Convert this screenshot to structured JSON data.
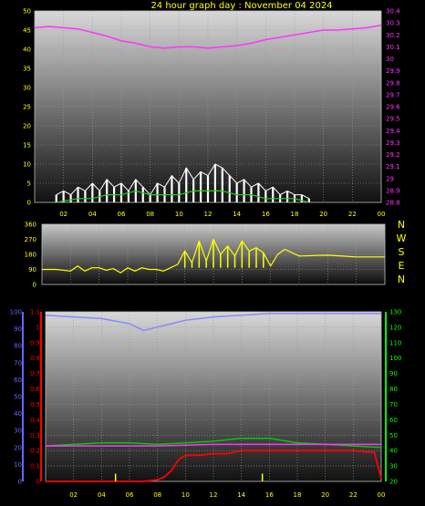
{
  "title": "24 hour graph day : November 04 2024",
  "colors": {
    "background": "#000000",
    "text": "#ffff00",
    "pressure": "#ff33ff",
    "wind_speed": "#ffffff",
    "wind_avg": "#22cc22",
    "wind_dir": "#ffff00",
    "humidity": "#8888ff",
    "temperature": "#00cc00",
    "rain_rate": "#ff0000",
    "rain_total": "#ffff00",
    "axis_blue": "#6666ff",
    "axis_red": "#ff0000",
    "axis_green": "#00ff00"
  },
  "chart_data": [
    {
      "type": "line",
      "name": "wind_and_pressure",
      "x_ticks": [
        "02",
        "04",
        "06",
        "08",
        "10",
        "12",
        "14",
        "16",
        "18",
        "20",
        "22",
        "00"
      ],
      "y_left": {
        "ticks": [
          "0",
          "5",
          "10",
          "15",
          "20",
          "25",
          "30",
          "35",
          "40",
          "45",
          "50"
        ],
        "range": [
          0,
          50
        ]
      },
      "y_right": {
        "ticks": [
          "28.8",
          "28.9",
          "29",
          "29.1",
          "29.2",
          "29.3",
          "29.4",
          "29.5",
          "29.6",
          "29.7",
          "29.8",
          "29.9",
          "30",
          "30.1",
          "30.2",
          "30.3",
          "30.4"
        ],
        "range": [
          28.8,
          30.4
        ]
      },
      "grid": true,
      "x_range": [
        0,
        24
      ],
      "series": [
        {
          "key": "pressure",
          "axis": "right",
          "x": [
            0,
            1,
            2,
            3,
            4,
            5,
            6,
            7,
            8,
            9,
            10,
            11,
            12,
            13,
            14,
            15,
            16,
            17,
            18,
            19,
            20,
            21,
            22,
            23,
            24
          ],
          "values": [
            30.26,
            30.27,
            30.26,
            30.25,
            30.22,
            30.19,
            30.15,
            30.13,
            30.1,
            30.09,
            30.1,
            30.1,
            30.09,
            30.1,
            30.11,
            30.13,
            30.16,
            30.18,
            30.2,
            30.22,
            30.24,
            30.24,
            30.25,
            30.26,
            30.28
          ]
        },
        {
          "key": "wind_speed",
          "axis": "left",
          "x": [
            1.5,
            2,
            2.5,
            3,
            3.5,
            4,
            4.5,
            5,
            5.5,
            6,
            6.5,
            7,
            7.5,
            8,
            8.5,
            9,
            9.5,
            10,
            10.5,
            11,
            11.5,
            12,
            12.5,
            13,
            13.5,
            14,
            14.5,
            15,
            15.5,
            16,
            16.5,
            17,
            17.5,
            18,
            18.5,
            19
          ],
          "values": [
            2,
            3,
            2,
            4,
            3,
            5,
            3,
            6,
            4,
            5,
            3,
            6,
            4,
            2,
            5,
            4,
            7,
            5,
            9,
            6,
            8,
            7,
            10,
            9,
            7,
            5,
            6,
            4,
            5,
            3,
            4,
            2,
            3,
            2,
            2,
            1
          ]
        },
        {
          "key": "wind_avg",
          "axis": "left",
          "x": [
            1.5,
            3,
            4,
            5,
            6,
            7,
            8,
            9,
            10,
            11,
            12,
            13,
            14,
            15,
            16,
            17,
            18,
            19
          ],
          "values": [
            0,
            1,
            1,
            2,
            2,
            3,
            2,
            2,
            2,
            3,
            3,
            3,
            2,
            2,
            1,
            1,
            1,
            0
          ]
        }
      ]
    },
    {
      "type": "line",
      "name": "wind_direction",
      "y_left": {
        "ticks": [
          "0",
          "90",
          "180",
          "270",
          "360"
        ],
        "range": [
          0,
          360
        ]
      },
      "direction_labels": [
        "N",
        "W",
        "S",
        "E",
        "N"
      ],
      "grid": true,
      "x_range": [
        0,
        24
      ],
      "series": [
        {
          "key": "wind_dir",
          "x": [
            0,
            1,
            2,
            2.5,
            3,
            3.5,
            4,
            4.5,
            5,
            5.5,
            6,
            6.5,
            7,
            7.5,
            8,
            8.5,
            9,
            9.5,
            10,
            10.5,
            11,
            11.5,
            12,
            12.5,
            13,
            13.5,
            14,
            14.5,
            15,
            15.5,
            16,
            16.5,
            17,
            18,
            20,
            22,
            24
          ],
          "values": [
            90,
            90,
            80,
            110,
            80,
            100,
            100,
            85,
            95,
            70,
            100,
            80,
            100,
            90,
            90,
            80,
            100,
            120,
            200,
            130,
            260,
            140,
            270,
            180,
            230,
            170,
            260,
            200,
            220,
            190,
            110,
            180,
            210,
            170,
            175,
            165,
            165
          ]
        }
      ]
    },
    {
      "type": "line",
      "name": "humidity_temperature_rain",
      "x_ticks": [
        "02",
        "04",
        "06",
        "08",
        "10",
        "12",
        "14",
        "16",
        "18",
        "20",
        "22",
        "00"
      ],
      "y_left_blue": {
        "ticks": [
          "0",
          "10",
          "20",
          "30",
          "40",
          "50",
          "60",
          "70",
          "80",
          "90",
          "100"
        ],
        "range": [
          0,
          100
        ]
      },
      "y_left_red": {
        "ticks": [
          "0",
          "0.1",
          "0.2",
          "0.3",
          "0.4",
          "0.5",
          "0.6",
          "0.7",
          "0.8",
          "0.9",
          "1",
          "1.1"
        ],
        "range": [
          0,
          1.1
        ]
      },
      "y_right": {
        "ticks": [
          "20",
          "30",
          "40",
          "50",
          "60",
          "70",
          "80",
          "90",
          "100",
          "110",
          "120",
          "130"
        ],
        "range": [
          20,
          130
        ]
      },
      "grid": true,
      "x_range": [
        0,
        24
      ],
      "series": [
        {
          "key": "humidity",
          "axis": "blue",
          "x": [
            0,
            2,
            4,
            6,
            7,
            8,
            9,
            10,
            12,
            14,
            16,
            18,
            20,
            22,
            24
          ],
          "values": [
            98,
            97,
            96,
            93,
            89,
            91,
            93,
            95,
            97,
            98,
            99,
            99,
            99,
            99,
            99
          ]
        },
        {
          "key": "temperature",
          "axis": "right",
          "x": [
            0,
            2,
            4,
            6,
            8,
            10,
            12,
            14,
            16,
            18,
            20,
            22,
            24
          ],
          "values": [
            43,
            44,
            45,
            45,
            44,
            45,
            46,
            48,
            48,
            45,
            44,
            43,
            42
          ]
        },
        {
          "key": "pressure",
          "axis": "red",
          "x": [
            0,
            4,
            8,
            12,
            16,
            20,
            24
          ],
          "values": [
            0.23,
            0.23,
            0.23,
            0.24,
            0.24,
            0.24,
            0.24
          ]
        },
        {
          "key": "rain_rate",
          "axis": "red",
          "x": [
            0,
            4,
            7,
            8,
            8.5,
            9,
            9.5,
            10,
            11,
            12,
            13,
            14,
            16,
            18,
            20,
            22,
            23,
            23.5,
            24
          ],
          "values": [
            0,
            0,
            0,
            0.01,
            0.03,
            0.07,
            0.14,
            0.17,
            0.17,
            0.18,
            0.18,
            0.2,
            0.2,
            0.2,
            0.2,
            0.2,
            0.19,
            0.19,
            0.02
          ]
        },
        {
          "key": "rain_total",
          "axis": "red",
          "type": "bars",
          "x": [
            5,
            15.5
          ],
          "values": [
            0.05,
            0.05
          ]
        }
      ]
    }
  ]
}
